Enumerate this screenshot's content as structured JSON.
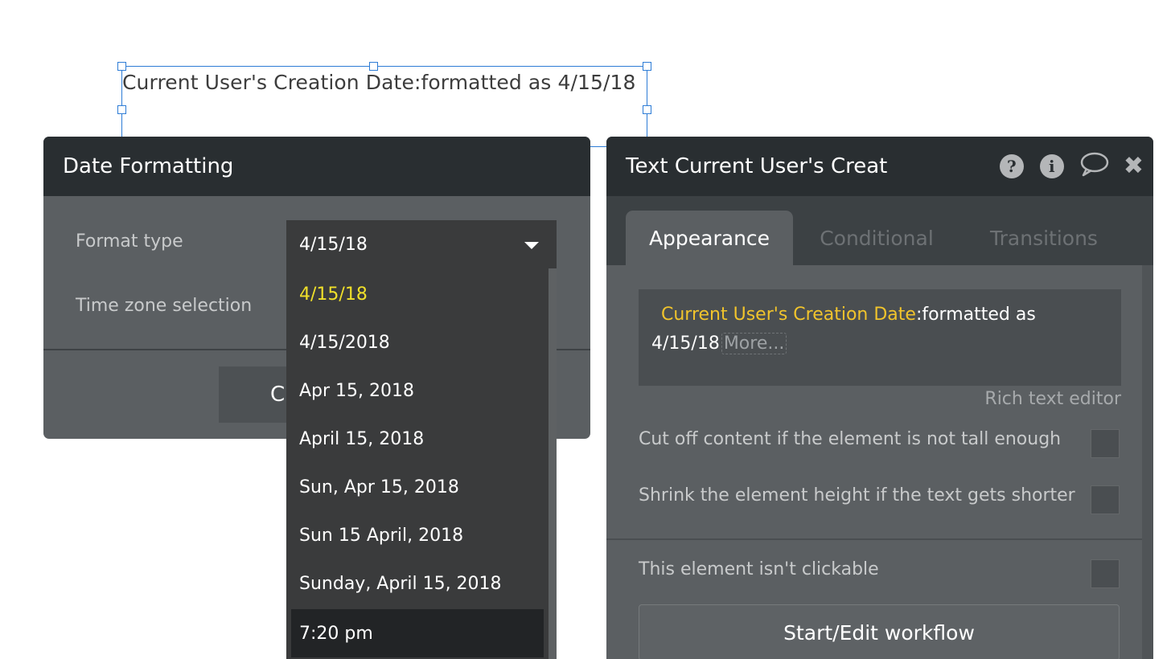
{
  "canvas": {
    "element_text": "Current User's Creation Date:formatted as 4/15/18"
  },
  "date_formatting_panel": {
    "title": "Date Formatting",
    "format_type_label": "Format type",
    "time_zone_label": "Time zone selection",
    "format_type_value": "4/15/18",
    "button_partial_label": "C",
    "options": [
      "4/15/18",
      "4/15/2018",
      "Apr 15, 2018",
      "April 15, 2018",
      "Sun, Apr 15, 2018",
      "Sun 15 April, 2018",
      "Sunday, April 15, 2018",
      "7:20 pm"
    ],
    "selected_option_color": "#f0e02a"
  },
  "property_editor": {
    "title": "Text Current User's Creat",
    "icons": [
      "help-icon",
      "info-icon",
      "comment-icon",
      "close-icon"
    ],
    "tabs": [
      {
        "label": "Appearance",
        "active": true
      },
      {
        "label": "Conditional",
        "active": false
      },
      {
        "label": "Transitions",
        "active": false
      }
    ],
    "text_expression": {
      "dynamic": "Current User's Creation Date",
      "operator_line1": ":formatted as",
      "operator_line2": "4/15/18",
      "more": "More..."
    },
    "dynamic_color": "#f1c42c",
    "rich_text_editor": "Rich text editor",
    "checkboxes": [
      {
        "label": "Cut off content if the element is not tall enough",
        "checked": false
      },
      {
        "label": "Shrink the element height if the text gets shorter",
        "checked": false
      },
      {
        "label": "This element isn't clickable",
        "checked": false
      }
    ],
    "workflow_button": "Start/Edit workflow"
  }
}
